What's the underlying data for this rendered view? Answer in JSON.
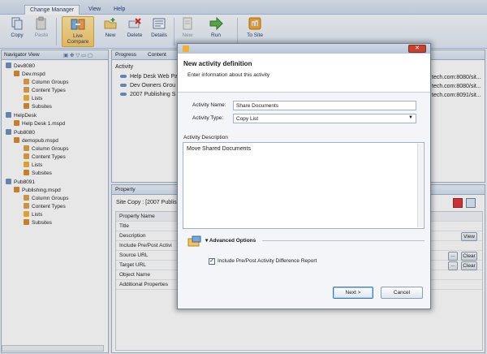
{
  "ribbon": {
    "tabs": [
      "Change Manager",
      "View",
      "Help"
    ],
    "buttons": {
      "copy": "Copy",
      "paste": "Paste",
      "live_compare": "Live Compare",
      "new": "New",
      "delete": "Delete",
      "details": "Details",
      "new2": "New",
      "run": "Run",
      "to_site": "To Site"
    }
  },
  "navigator": {
    "title": "Navigator View",
    "tree": [
      "Dev8080",
      "Dev.mspd",
      "Column Groups",
      "Content Types",
      "Lists",
      "Subsites",
      "HelpDesk",
      "Help Desk 1.mspd",
      "Pub8080",
      "demopub.mspd",
      "Column Groups",
      "Content Types",
      "Lists",
      "Subsites",
      "Pub8091",
      "Publishing.mspd",
      "Column Groups",
      "Content Types",
      "Lists",
      "Subsites"
    ]
  },
  "progress": {
    "tabs": [
      "Progress",
      "Content"
    ],
    "column": "Activity",
    "rows": [
      "Help Desk Web Pa",
      "Dev Owners Grou",
      "2007 Publishing S"
    ],
    "right_values": [
      "tech.com:8080/sit...",
      "tech.com:8080/sit...",
      "tech.com:8091/sit..."
    ]
  },
  "property": {
    "tab": "Property",
    "site_copy": "Site Copy : [2007 Publish",
    "column": "Property Name",
    "rows": [
      "Title",
      "Description",
      "Include Pre/Post Activi",
      "Source URL",
      "Target URL",
      "Object Name",
      "Additional Properties"
    ],
    "view_button": "View",
    "ellipsis": "...",
    "clear_button": "Clear"
  },
  "dialog": {
    "title": "New activity definition",
    "subtitle": "Enter information about this activity",
    "activity_name_label": "Activity Name:",
    "activity_name_value": "Share Documents",
    "activity_type_label": "Activity Type:",
    "activity_type_value": "Copy List",
    "description_label": "Activity Description",
    "description_value": "Move Shared Documents",
    "advanced_label": "Advanced Options",
    "checkbox_label": "Include Pre/Post Activity Difference Report",
    "checkbox_checked": true,
    "next_button": "Next >",
    "cancel_button": "Cancel"
  },
  "colors": {
    "accent": "#1e3a6e",
    "selected_button": "#f8c866",
    "dialog_border": "#6f7f93"
  }
}
